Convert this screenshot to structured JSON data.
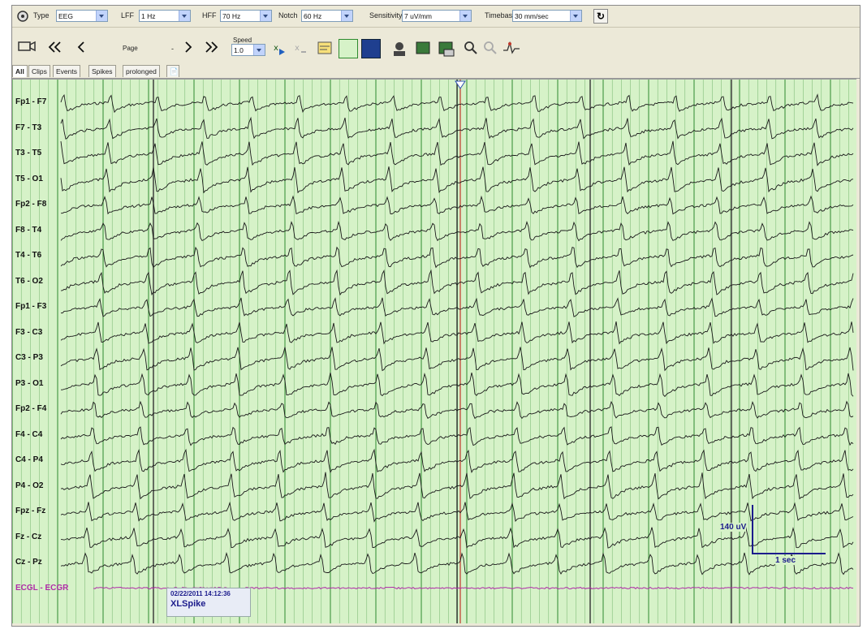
{
  "toolbar": {
    "type_label": "Type",
    "type_value": "EEG",
    "lff_label": "LFF",
    "lff_value": "1 Hz",
    "hff_label": "HFF",
    "hff_value": "70 Hz",
    "notch_label": "Notch",
    "notch_value": "60 Hz",
    "sensitivity_label": "Sensitivity",
    "sensitivity_value": "7 uV/mm",
    "timebase_label": "Timebase",
    "timebase_value": "30 mm/sec",
    "page_label": "Page",
    "page_separator": "-",
    "speed_label": "Speed",
    "speed_value": "1.0"
  },
  "tabs": [
    {
      "label": "All",
      "active": true
    },
    {
      "label": "Clips",
      "active": false
    },
    {
      "label": "Events",
      "active": false
    },
    {
      "label": "Spikes",
      "active": false
    },
    {
      "label": "prolonged",
      "active": false
    }
  ],
  "channels": [
    "Fp1 - F7",
    "F7 - T3",
    "T3 - T5",
    "T5 - O1",
    "Fp2 - F8",
    "F8 - T4",
    "T4 - T6",
    "T6 - O2",
    "Fp1 - F3",
    "F3 - C3",
    "C3 - P3",
    "P3 - O1",
    "Fp2 - F4",
    "F4 - C4",
    "C4 - P4",
    "P4 - O2",
    "Fpz - Fz",
    "Fz - Cz",
    "Cz - Pz",
    "ECGL - ECGR"
  ],
  "scale": {
    "amplitude_label": "140 uV",
    "time_label": "1 sec"
  },
  "annotation": {
    "timestamp": "02/22/2011 14:12:36",
    "label": "XLSpike"
  },
  "colors": {
    "grid_bg": "#d6f2c8",
    "grid_line": "#2e8a2e",
    "trace": "#1a1a1a",
    "ecg": "#b02aa8",
    "scale_bar": "#1c1c8c",
    "cursor": "#c0392b"
  }
}
